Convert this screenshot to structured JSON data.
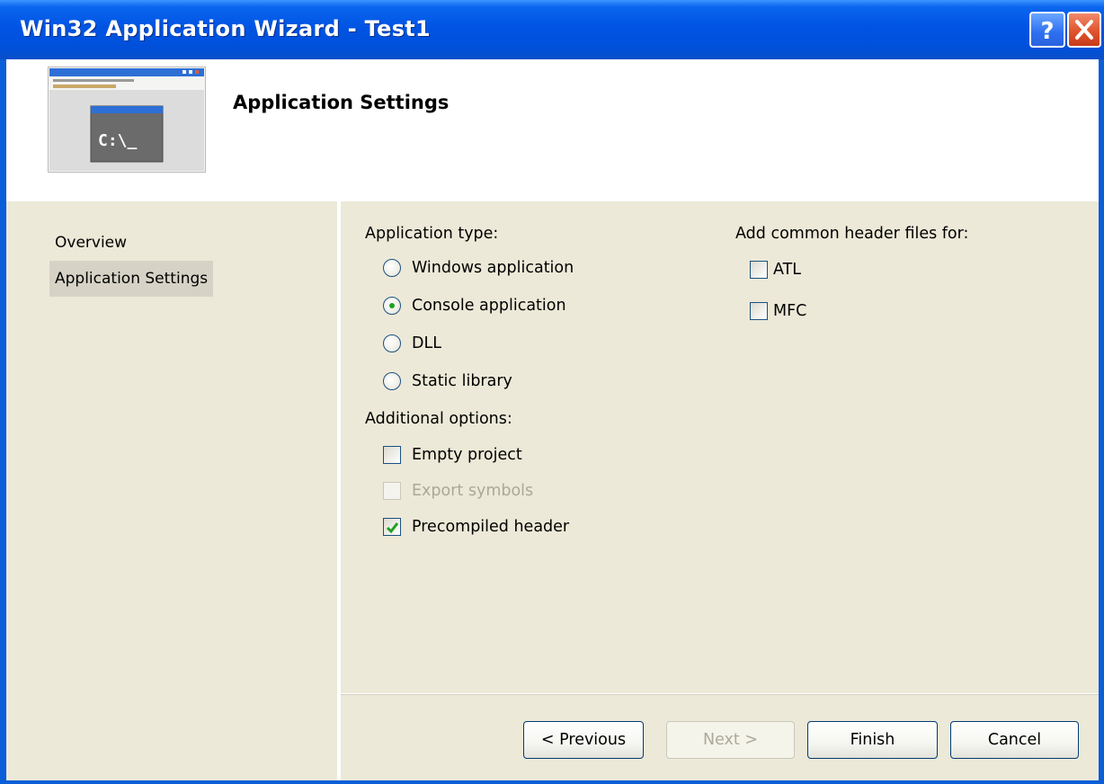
{
  "window": {
    "title": "Win32 Application Wizard - Test1",
    "help_icon": "question-mark-icon",
    "close_icon": "close-x-icon"
  },
  "header": {
    "title": "Application Settings",
    "image_icon": "console-app-icon",
    "console_prompt": "C:\\_"
  },
  "nav": {
    "items": [
      {
        "label": "Overview",
        "active": false
      },
      {
        "label": "Application Settings",
        "active": true
      }
    ]
  },
  "application_type": {
    "label": "Application type:",
    "options": [
      {
        "label": "Windows application",
        "checked": false
      },
      {
        "label": "Console application",
        "checked": true
      },
      {
        "label": "DLL",
        "checked": false
      },
      {
        "label": "Static library",
        "checked": false
      }
    ]
  },
  "additional_options": {
    "label": "Additional options:",
    "options": [
      {
        "label": "Empty project",
        "checked": false,
        "enabled": true
      },
      {
        "label": "Export symbols",
        "checked": false,
        "enabled": false
      },
      {
        "label": "Precompiled header",
        "checked": true,
        "enabled": true
      }
    ]
  },
  "common_headers": {
    "label": "Add common header files for:",
    "options": [
      {
        "label": "ATL",
        "checked": false
      },
      {
        "label": "MFC",
        "checked": false
      }
    ]
  },
  "buttons": {
    "previous": "< Previous",
    "next": "Next >",
    "finish": "Finish",
    "cancel": "Cancel"
  },
  "colors": {
    "titlebar": "#0054e3",
    "dialog_face": "#ece9d8",
    "radio_dot": "#21a121",
    "check_mark": "#21a121"
  }
}
